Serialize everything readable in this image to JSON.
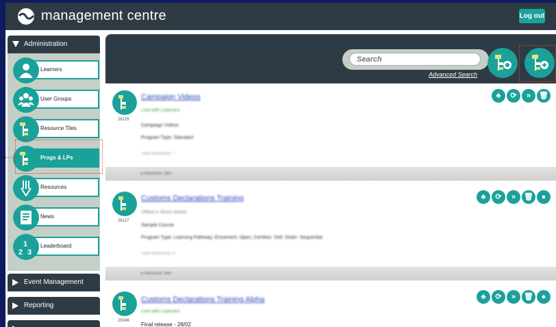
{
  "header": {
    "app_title": "management centre",
    "logout_label": "Log out",
    "logo_icon": "wave-logo-icon"
  },
  "sidebar": {
    "administration_label": "Administration",
    "items": [
      {
        "label": "Learners",
        "icon": "user-icon"
      },
      {
        "label": "User Groups",
        "icon": "users-icon"
      },
      {
        "label": "Resource Tiles",
        "icon": "tiles-icon"
      },
      {
        "label": "Progs & LPs",
        "icon": "programme-icon",
        "active": true
      },
      {
        "label": "Resources",
        "icon": "resources-icon"
      },
      {
        "label": "News",
        "icon": "news-icon"
      },
      {
        "label": "Leaderboard",
        "icon": "leaderboard-icon"
      }
    ],
    "sections": [
      {
        "label": "Event Management"
      },
      {
        "label": "Reporting"
      }
    ]
  },
  "search": {
    "placeholder": "Search",
    "advanced_label": "Advanced Search"
  },
  "programmes": [
    {
      "id": "26135",
      "title": "Campaign Videos",
      "subtitle": "Live with Learners",
      "line1": "Campaign Videos",
      "line2": "Program Type: Standard",
      "faint": "Total Resources: 7",
      "footer": "▸ Resource Tiles"
    },
    {
      "id": "26137",
      "title": "Customs Declarations Training",
      "subtitle": "Offline ▸ Show details",
      "line1": "Sample Course",
      "line2": "Program Type: Learning Pathway; Enrolment: Open; Certifies: Self; Order: Sequential",
      "faint": "Total Resources: 3",
      "footer": "▸ Resource Tiles"
    },
    {
      "id": "26348",
      "title": "Customs Declarations Training Alpha",
      "subtitle": "Live with Learners",
      "line1": "Final release - 28/02"
    }
  ],
  "colors": {
    "accent": "#1aa19a",
    "dark": "#2f3b44",
    "background": "#101a5e",
    "highlight": "#e03b2e"
  }
}
